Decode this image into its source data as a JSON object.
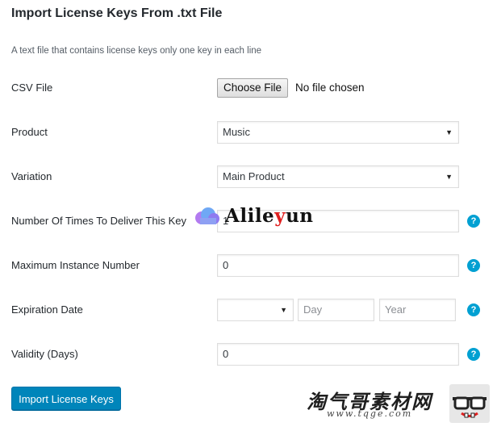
{
  "header": {
    "title": "Import License Keys From .txt File",
    "description": "A text file that contains license keys only one key in each line"
  },
  "form": {
    "csv_file": {
      "label": "CSV File",
      "button_label": "Choose File",
      "status": "No file chosen"
    },
    "product": {
      "label": "Product",
      "value": "Music"
    },
    "variation": {
      "label": "Variation",
      "value": "Main Product"
    },
    "deliver_times": {
      "label": "Number Of Times To Deliver This Key",
      "value": "1"
    },
    "max_instance": {
      "label": "Maximum Instance Number",
      "value": "0"
    },
    "expiration": {
      "label": "Expiration Date",
      "month_value": "",
      "day_placeholder": "Day",
      "year_placeholder": "Year"
    },
    "validity": {
      "label": "Validity (Days)",
      "value": "0"
    },
    "submit_label": "Import License Keys"
  },
  "help_symbol": "?",
  "icons": {
    "help": "question-circle-icon",
    "select": "caret-down-icon"
  },
  "colors": {
    "primary": "#0085ba",
    "help": "#00a0d2",
    "text": "#23282d"
  },
  "watermarks": {
    "alileyun_pre": "Alile",
    "alileyun_accent": "y",
    "alileyun_post": "un",
    "tqge_cn": "淘气哥素材网",
    "tqge_url": "www.tqge.com"
  }
}
